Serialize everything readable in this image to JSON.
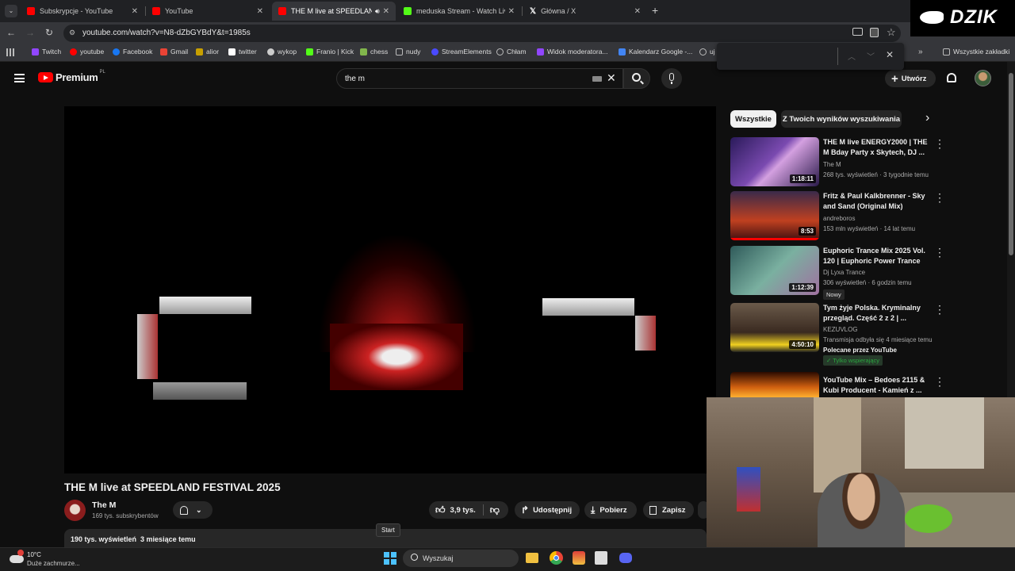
{
  "browser": {
    "tabs": [
      {
        "label": "Subskrypcje - YouTube",
        "favicon_color": "#ff0000"
      },
      {
        "label": "YouTube",
        "favicon_color": "#ff0000"
      },
      {
        "label": "THE M live at SPEEDLAND F",
        "favicon_color": "#ff0000",
        "active": true
      },
      {
        "label": "meduska Stream - Watch Live o",
        "favicon_color": "#53fc18"
      },
      {
        "label": "Główna / X",
        "favicon_color": "#ffffff"
      }
    ],
    "new_tab": "+",
    "url": "youtube.com/watch?v=N8-dZbGYBdY&t=1985s",
    "bookmarks": [
      {
        "label": "Twitch",
        "color": "#9146ff"
      },
      {
        "label": "youtube",
        "color": "#ff0000"
      },
      {
        "label": "Facebook",
        "color": "#1877f2"
      },
      {
        "label": "Gmail",
        "color": "#ea4335"
      },
      {
        "label": "alior",
        "color": "#c8a000"
      },
      {
        "label": "twitter",
        "color": "#ffffff"
      },
      {
        "label": "wykop",
        "color": "#cccccc"
      },
      {
        "label": "Franio | Kick",
        "color": "#53fc18"
      },
      {
        "label": "chess",
        "color": "#81b64c"
      },
      {
        "label": "nudy",
        "color": "#bbbbbb"
      },
      {
        "label": "StreamElements",
        "color": "#4a4aff"
      },
      {
        "label": "Chłam",
        "color": "#bbbbbb"
      },
      {
        "label": "Widok moderatora...",
        "color": "#9146ff"
      },
      {
        "label": "Kalendarz Google -...",
        "color": "#4285f4"
      },
      {
        "label": "uj",
        "color": "#bbbbbb"
      }
    ],
    "all_bookmarks": "Wszystkie zakładki"
  },
  "youtube": {
    "logo_text": "Premium",
    "logo_badge": "PL",
    "search_value": "the m",
    "create_label": "Utwórz",
    "video": {
      "title": "THE M live at SPEEDLAND FESTIVAL 2025",
      "channel": "The M",
      "subscribers": "169 tys. subskrybentów",
      "likes": "3,9 tys.",
      "share": "Udostępnij",
      "download": "Pobierz",
      "save": "Zapisz",
      "views_line": "190 tys. wyświetleń  3 miesiące temu"
    },
    "filters": [
      "Wszystkie",
      "Z Twoich wyników wyszukiwania"
    ],
    "recommendations": [
      {
        "title": "THE M live ENERGY2000 | THE M Bday Party x Skytech, DJ ...",
        "channel": "The M",
        "meta": "268 tys. wyświetleń · 3 tygodnie temu",
        "duration": "1:18:11",
        "thumb": "#3a2a6a"
      },
      {
        "title": "Fritz & Paul Kalkbrenner - Sky and Sand (Original Mix)",
        "channel": "andreboros",
        "meta": "153 mln wyświetleń · 14 lat temu",
        "duration": "8:53",
        "thumb": "#7a2a20"
      },
      {
        "title": "Euphoric Trance Mix 2025 Vol. 120 | Euphoric Power Trance",
        "channel": "Dj Lyxa Trance",
        "meta": "306 wyświetleń · 6 godzin temu",
        "duration": "1:12:39",
        "badge": "Nowy",
        "thumb": "#3f6a6a"
      },
      {
        "title": "Tym żyje Polska. Kryminalny przegląd. Część 2 z 2 | ...",
        "channel": "KEZUVLOG",
        "meta": "Transmisja odbyła się 4 miesiące temu",
        "extra": "Polecane przez YouTube",
        "badge": "Tylko wspierający",
        "duration": "4:50:10",
        "thumb": "#5a4a3a"
      },
      {
        "title": "YouTube Mix – Bedoes 2115 & Kubi Producent - Kamień z ...",
        "channel": "",
        "meta": "",
        "duration": "",
        "thumb": "#6a2a10"
      }
    ]
  },
  "taskbar": {
    "weather_temp": "10°C",
    "weather_desc": "Duże zachmurze...",
    "search_placeholder": "Wyszukaj",
    "start_tooltip": "Start"
  },
  "overlay": {
    "brand": "DZIK"
  },
  "colors": {
    "youtube_red": "#ff0000",
    "accent_blue": "#3ea6ff",
    "supporter_green": "#2ba640"
  }
}
